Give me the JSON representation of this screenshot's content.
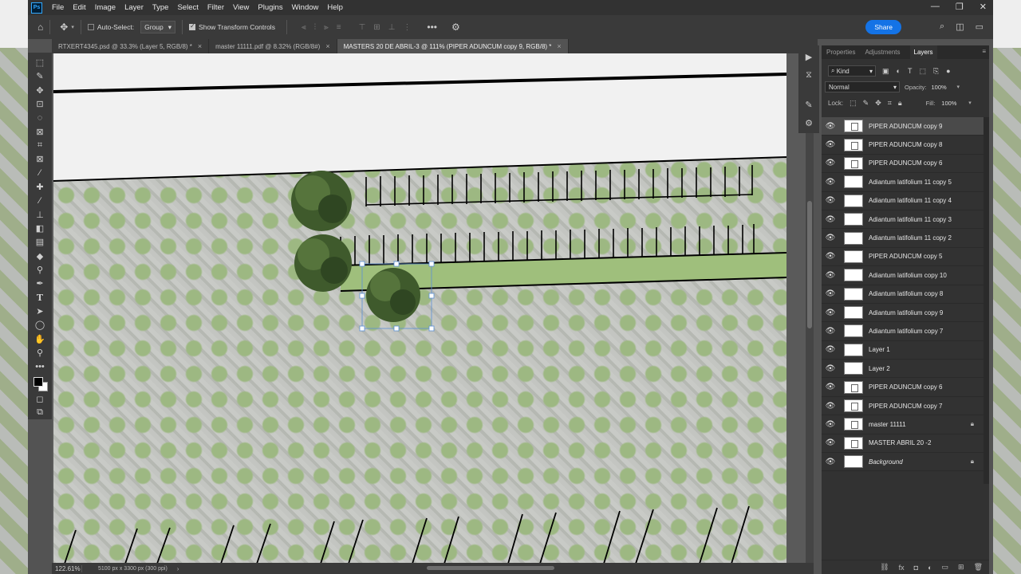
{
  "app": {
    "logo_text": "Ps",
    "menu": [
      "File",
      "Edit",
      "Image",
      "Layer",
      "Type",
      "Select",
      "Filter",
      "View",
      "Plugins",
      "Window",
      "Help"
    ],
    "window_controls": [
      "—",
      "❐",
      "✕"
    ]
  },
  "options_bar": {
    "auto_select_label": "Auto-Select:",
    "auto_select_checked": false,
    "auto_select_target": "Group",
    "show_transform_label": "Show Transform Controls",
    "show_transform_checked": true,
    "share_label": "Share"
  },
  "tabs": [
    {
      "label": "RTXERT4345.psd @ 33.3% (Layer 5, RGB/8) *",
      "active": false
    },
    {
      "label": "master 11111.pdf @ 8.32% (RGB/8#)",
      "active": false
    },
    {
      "label": "MASTERS 20 DE ABRIL-3 @ 111% (PIPER ADUNCUM copy 9, RGB/8) *",
      "active": true
    }
  ],
  "tools": [
    "rect-marquee-icon",
    "paint-icon",
    "move-icon",
    "artboard-icon",
    "lasso-icon",
    "select-subject-icon",
    "crop-icon",
    "frame-icon",
    "eyedropper-icon",
    "healing-icon",
    "brush-icon",
    "stamp-icon",
    "eraser-icon",
    "gradient-icon",
    "blur-icon",
    "dodge-icon",
    "pen-icon",
    "type-icon",
    "path-select-icon",
    "ellipse-icon",
    "hand-icon",
    "zoom-icon",
    "more-icon"
  ],
  "status": {
    "zoom": "122.61%",
    "doc_info": "5100 px x 3300 px (300 ppi)"
  },
  "panel": {
    "tabs": [
      "Properties",
      "Adjustments",
      "Layers"
    ],
    "active_tab": "Layers",
    "kind_label": "Kind",
    "blend_mode": "Normal",
    "opacity_label": "Opacity:",
    "opacity_value": "100%",
    "lock_label": "Lock:",
    "fill_label": "Fill:",
    "fill_value": "100%"
  },
  "layers": [
    {
      "name": "PIPER ADUNCUM copy 9",
      "selected": true,
      "locked": false,
      "thumb": "pic",
      "italic": false
    },
    {
      "name": "PIPER ADUNCUM copy 8",
      "selected": false,
      "locked": false,
      "thumb": "pic",
      "italic": false
    },
    {
      "name": "PIPER ADUNCUM copy 6",
      "selected": false,
      "locked": false,
      "thumb": "pic",
      "italic": false
    },
    {
      "name": "Adiantum latifolium 11 copy 5",
      "selected": false,
      "locked": false,
      "thumb": "blank",
      "italic": false
    },
    {
      "name": "Adiantum latifolium 11 copy 4",
      "selected": false,
      "locked": false,
      "thumb": "blank",
      "italic": false
    },
    {
      "name": "Adiantum latifolium 11 copy 3",
      "selected": false,
      "locked": false,
      "thumb": "blank",
      "italic": false
    },
    {
      "name": "Adiantum latifolium 11 copy 2",
      "selected": false,
      "locked": false,
      "thumb": "blank",
      "italic": false
    },
    {
      "name": "PIPER ADUNCUM copy 5",
      "selected": false,
      "locked": false,
      "thumb": "blank",
      "italic": false
    },
    {
      "name": "Adiantum latifolium copy 10",
      "selected": false,
      "locked": false,
      "thumb": "blank",
      "italic": false
    },
    {
      "name": "Adiantum latifolium copy 8",
      "selected": false,
      "locked": false,
      "thumb": "blank",
      "italic": false
    },
    {
      "name": "Adiantum latifolium copy 9",
      "selected": false,
      "locked": false,
      "thumb": "blank",
      "italic": false
    },
    {
      "name": "Adiantum latifolium copy 7",
      "selected": false,
      "locked": false,
      "thumb": "blank",
      "italic": false
    },
    {
      "name": "Layer 1",
      "selected": false,
      "locked": false,
      "thumb": "blank",
      "italic": false
    },
    {
      "name": "Layer 2",
      "selected": false,
      "locked": false,
      "thumb": "blank",
      "italic": false
    },
    {
      "name": "PIPER ADUNCUM copy 6",
      "selected": false,
      "locked": false,
      "thumb": "pic",
      "italic": false
    },
    {
      "name": "PIPER ADUNCUM copy 7",
      "selected": false,
      "locked": false,
      "thumb": "pic",
      "italic": false
    },
    {
      "name": "master 11111",
      "selected": false,
      "locked": true,
      "thumb": "pic",
      "italic": false
    },
    {
      "name": "MASTER ABRIL 20 -2",
      "selected": false,
      "locked": false,
      "thumb": "pic",
      "italic": false
    },
    {
      "name": "Background",
      "selected": false,
      "locked": true,
      "thumb": "blank",
      "italic": true
    }
  ],
  "colors": {
    "accent": "#1473e6",
    "panel_bg": "#323232",
    "paving_green": "#9db882",
    "strip_green": "#9fbf7c",
    "tree_green": "#3f5a2c"
  }
}
